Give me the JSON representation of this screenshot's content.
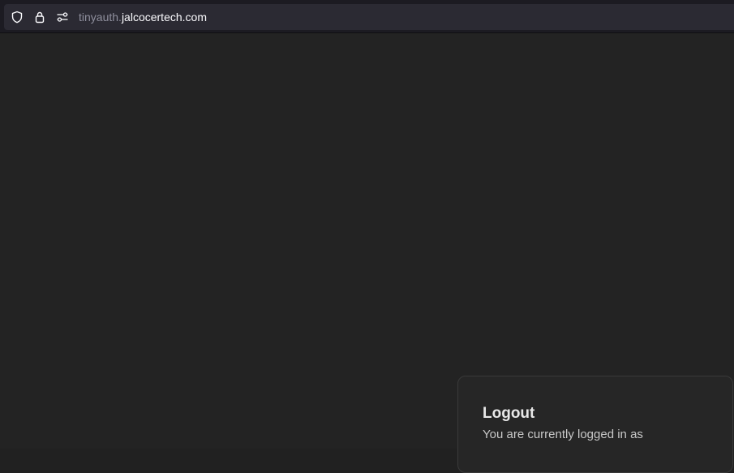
{
  "browser": {
    "url_subdomain": "tinyauth.",
    "url_domain": "jalcocertech.com",
    "icons": [
      "shield-icon",
      "lock-icon",
      "permissions-icon"
    ]
  },
  "card": {
    "title": "Logout",
    "message": "You are currently logged in as"
  },
  "colors": {
    "page_background": "#232323",
    "urlbar_background": "#2b2a33",
    "card_border": "#3a3a3a"
  }
}
